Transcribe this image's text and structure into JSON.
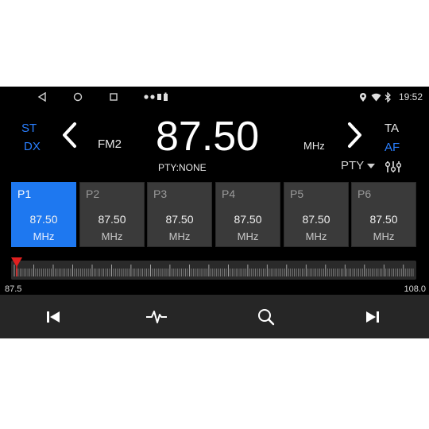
{
  "status": {
    "time": "19:52"
  },
  "radio": {
    "stereo": "ST",
    "dx": "DX",
    "band": "FM2",
    "frequency": "87.50",
    "unit": "MHz",
    "pty_status": "PTY:NONE",
    "ta": "TA",
    "af": "AF",
    "pty_menu": "PTY"
  },
  "presets": [
    {
      "name": "P1",
      "freq": "87.50",
      "unit": "MHz",
      "active": true
    },
    {
      "name": "P2",
      "freq": "87.50",
      "unit": "MHz",
      "active": false
    },
    {
      "name": "P3",
      "freq": "87.50",
      "unit": "MHz",
      "active": false
    },
    {
      "name": "P4",
      "freq": "87.50",
      "unit": "MHz",
      "active": false
    },
    {
      "name": "P5",
      "freq": "87.50",
      "unit": "MHz",
      "active": false
    },
    {
      "name": "P6",
      "freq": "87.50",
      "unit": "MHz",
      "active": false
    }
  ],
  "tuner": {
    "min": "87.5",
    "max": "108.0",
    "current": 87.5
  },
  "icons": {
    "nav": [
      "back-triangle-icon",
      "home-circle-icon",
      "recents-square-icon"
    ],
    "notifications": [
      "dot-icon",
      "dot-icon",
      "usb-icon",
      "battery-icon"
    ],
    "status": [
      "location-icon",
      "wifi-icon",
      "bluetooth-icon"
    ],
    "bottom": [
      "previous-track-icon",
      "seek-wave-icon",
      "search-icon",
      "next-track-icon"
    ]
  },
  "colors": {
    "accent": "#1e78f0",
    "active_label": "#2a7fff",
    "marker": "#e02020"
  }
}
